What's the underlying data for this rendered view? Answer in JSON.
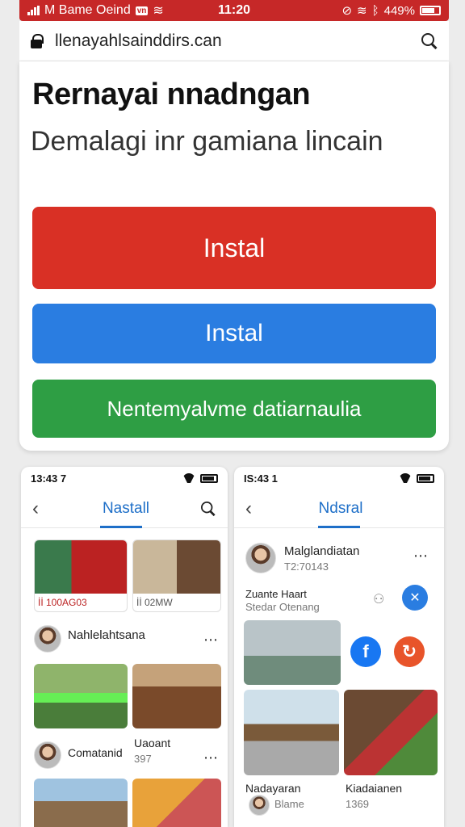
{
  "status_bar": {
    "carrier": "M Bame Oeind",
    "time": "11:20",
    "battery": "449%",
    "color": "#c62828"
  },
  "browser": {
    "url": "llenayahlsainddirs.can"
  },
  "hero": {
    "title": "Rernayai nnadngan",
    "subtitle": "Demalagi inr gamiana lincain"
  },
  "buttons": {
    "install_red": "Instal",
    "install_blue": "Instal",
    "green": "Nentemyalvme datiarnaulia"
  },
  "colors": {
    "red": "#d93025",
    "blue": "#2a7de1",
    "green": "#2e9e44",
    "accent": "#1e6fc8"
  },
  "phone_left": {
    "time": "13:43 7",
    "tab_title": "Nastall",
    "thumbs": [
      {
        "caption": "İİ 100AG03"
      },
      {
        "caption": "İİ 02MW"
      }
    ],
    "user1": "Nahlelahtsana",
    "user2": "Comatanid",
    "post2_title": "Uaoant",
    "post2_meta": "397"
  },
  "phone_right": {
    "time": "IS:43 1",
    "tab_title": "Ndsral",
    "profile_name": "Malglandiatan",
    "profile_meta": "T2:70143",
    "sub_name": "Zuante Haart",
    "sub_meta": "Stedar Otenang",
    "post_left_name": "Nadayaran",
    "post_left_meta": "Blame",
    "post_right_name": "Kiadaianen",
    "post_right_meta": "1369",
    "social_icons": [
      "facebook-icon",
      "share-icon"
    ]
  }
}
